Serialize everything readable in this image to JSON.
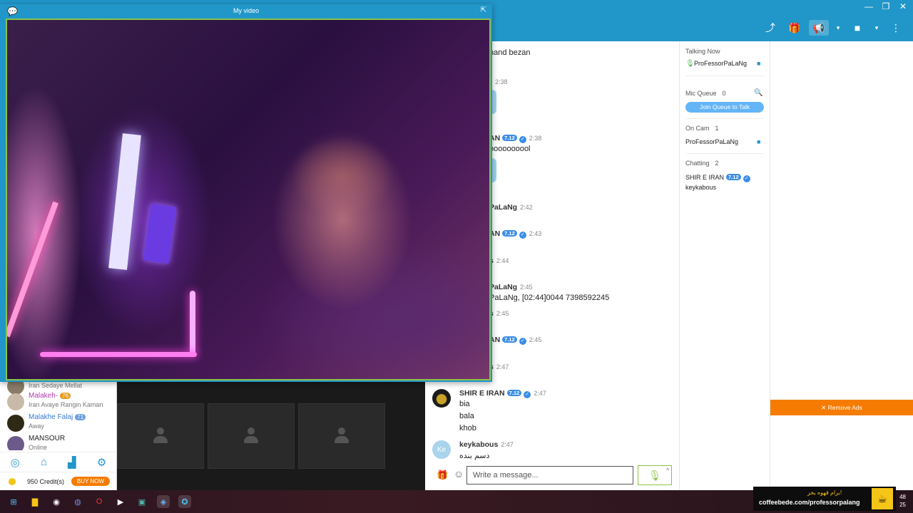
{
  "window": {
    "title": "My video"
  },
  "toolbar": {
    "items": [
      "share-icon",
      "gift-icon",
      "announce-icon",
      "dropdown-icon",
      "camera-icon",
      "dropdown-icon",
      "more-icon"
    ]
  },
  "left_users": [
    {
      "name": "",
      "status": "Iran Sedaye Mellat"
    },
    {
      "name": "Malakeh-",
      "badge": "76",
      "status": "Iran Avaye Rangin Kaman"
    },
    {
      "name": "Malakhe Falaj",
      "badge": "71",
      "status": "Away"
    },
    {
      "name": "MANSOUR",
      "status": "Online"
    }
  ],
  "credits": {
    "text": "950 Credit(s)",
    "buy": "BUY NOW"
  },
  "chat": {
    "messages": [
      {
        "text": "hand bezan"
      },
      {
        "time": "2:38"
      },
      {
        "name": "AN",
        "badge": "7.12",
        "time": "2:38",
        "text": "oooooooool"
      },
      {
        "name": "PaLaNg",
        "time": "2:42"
      },
      {
        "name": "AN",
        "badge": "7.12",
        "time": "2:43"
      },
      {
        "name": "s",
        "time": "2:44"
      },
      {
        "name": "PaLaNg",
        "time": "2:45",
        "text": "PaLaNg, [02:44]0044 7398592245"
      },
      {
        "name": "s",
        "time": "2:45"
      },
      {
        "name": "AN",
        "badge": "7.12",
        "time": "2:45"
      },
      {
        "name": "s",
        "time": "2:47"
      },
      {
        "name": "SHIR E IRAN",
        "badge": "7.12",
        "time": "2:47",
        "lines": [
          "bia",
          "bala",
          "khob"
        ]
      },
      {
        "name": "keykabous",
        "time": "2:47",
        "avatar": "Ke",
        "text": "دسم بنده"
      }
    ],
    "placeholder": "Write a message..."
  },
  "users_panel": {
    "talking_now": {
      "label": "Talking Now",
      "user": "ProFessorPaLaNg"
    },
    "mic_queue": {
      "label": "Mic Queue",
      "count": "0",
      "join": "Join Queue to Talk"
    },
    "on_cam": {
      "label": "On Cam",
      "count": "1",
      "user": "ProFessorPaLaNg"
    },
    "chatting": {
      "label": "Chatting",
      "count": "2",
      "users": [
        "SHIR E IRAN",
        "keykabous"
      ],
      "badge": "7.12"
    }
  },
  "ads": {
    "remove": "✕ Remove Ads"
  },
  "coffee_ad": {
    "persian": "برام قهوه بخر!",
    "url": "coffeebede.com/professorpalang"
  },
  "clock": {
    "time": "48",
    "date": "25"
  }
}
